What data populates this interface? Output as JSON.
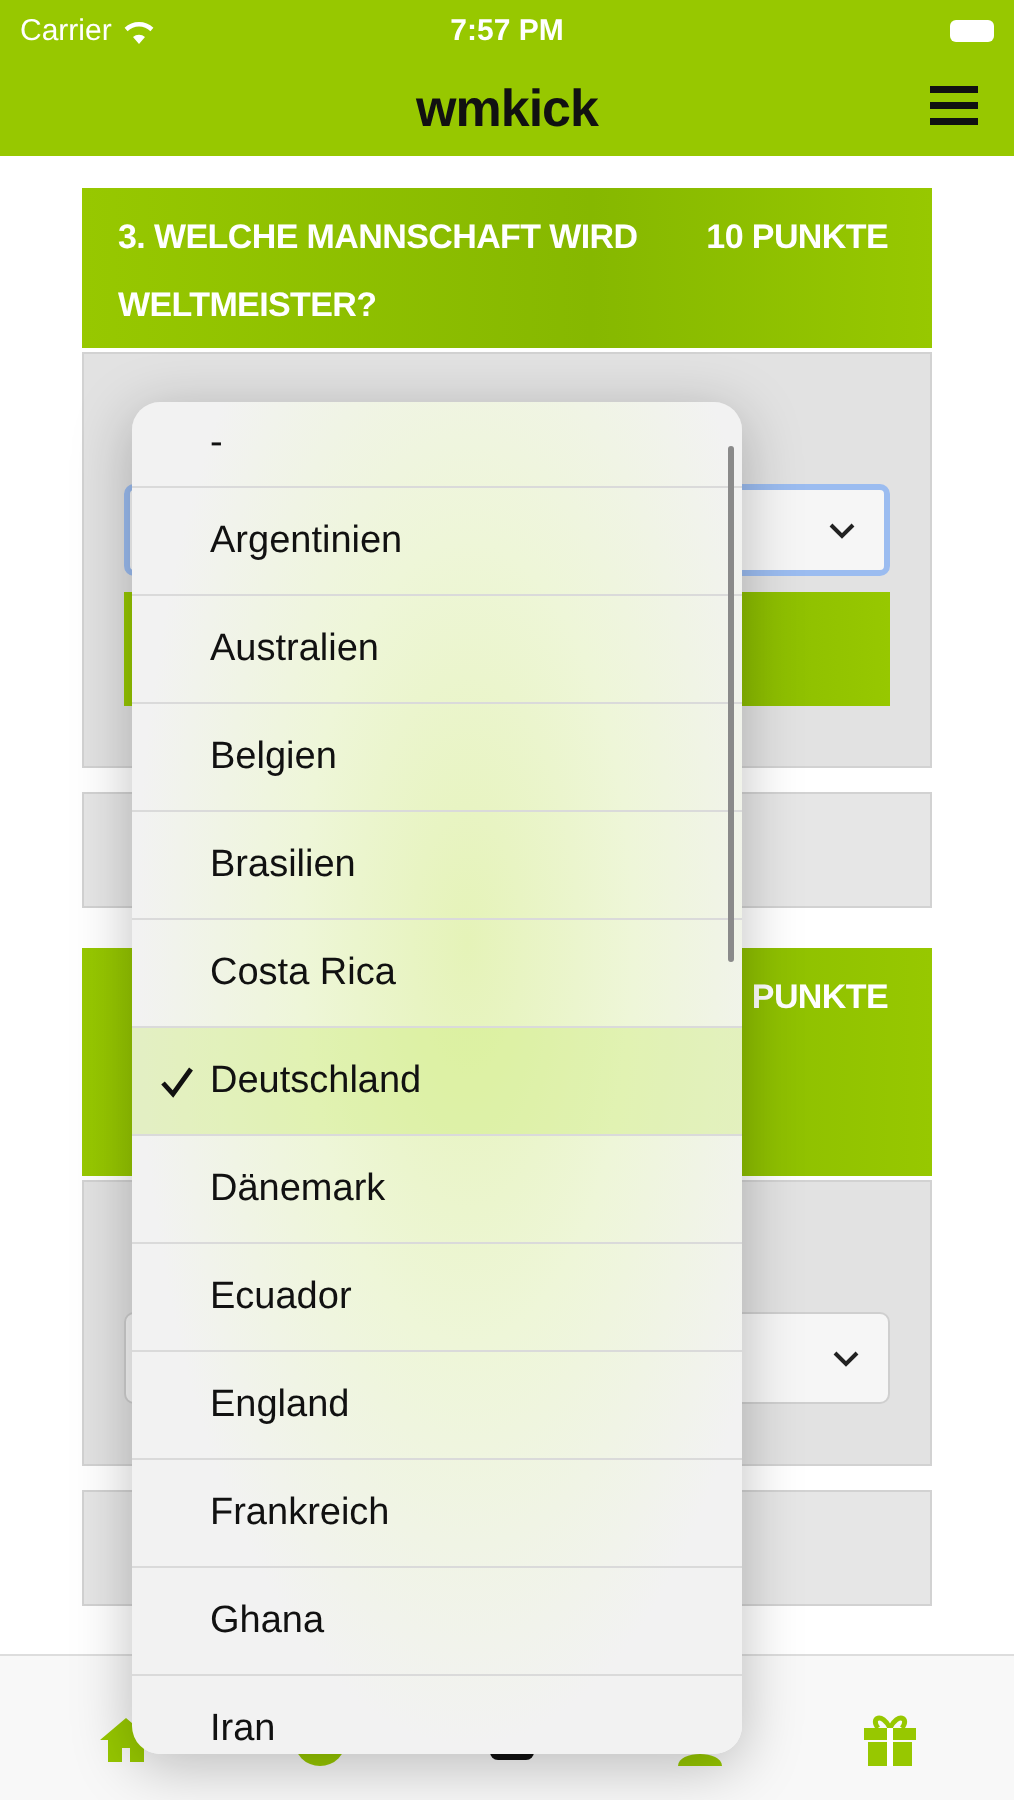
{
  "status_bar": {
    "carrier": "Carrier",
    "time": "7:57 PM"
  },
  "header": {
    "title": "wmkick"
  },
  "cards": [
    {
      "kind": "with_button",
      "title": "3. WELCHE MANNSCHAFT WIRD WELTMEISTER?",
      "points": "10 PUNKTE",
      "select_focused": true
    },
    {
      "kind": "plain",
      "points": "PUNKTE",
      "select_focused": false
    }
  ],
  "dropdown": {
    "options": [
      {
        "label": "-",
        "selected": false
      },
      {
        "label": "Argentinien",
        "selected": false
      },
      {
        "label": "Australien",
        "selected": false
      },
      {
        "label": "Belgien",
        "selected": false
      },
      {
        "label": "Brasilien",
        "selected": false
      },
      {
        "label": "Costa Rica",
        "selected": false
      },
      {
        "label": "Deutschland",
        "selected": true
      },
      {
        "label": "Dänemark",
        "selected": false
      },
      {
        "label": "Ecuador",
        "selected": false
      },
      {
        "label": "England",
        "selected": false
      },
      {
        "label": "Frankreich",
        "selected": false
      },
      {
        "label": "Ghana",
        "selected": false
      },
      {
        "label": "Iran",
        "selected": false
      }
    ]
  },
  "tab_bar": [
    {
      "kind": "home"
    },
    {
      "kind": "ball"
    },
    {
      "kind": "center"
    },
    {
      "kind": "person"
    },
    {
      "kind": "gift"
    }
  ]
}
